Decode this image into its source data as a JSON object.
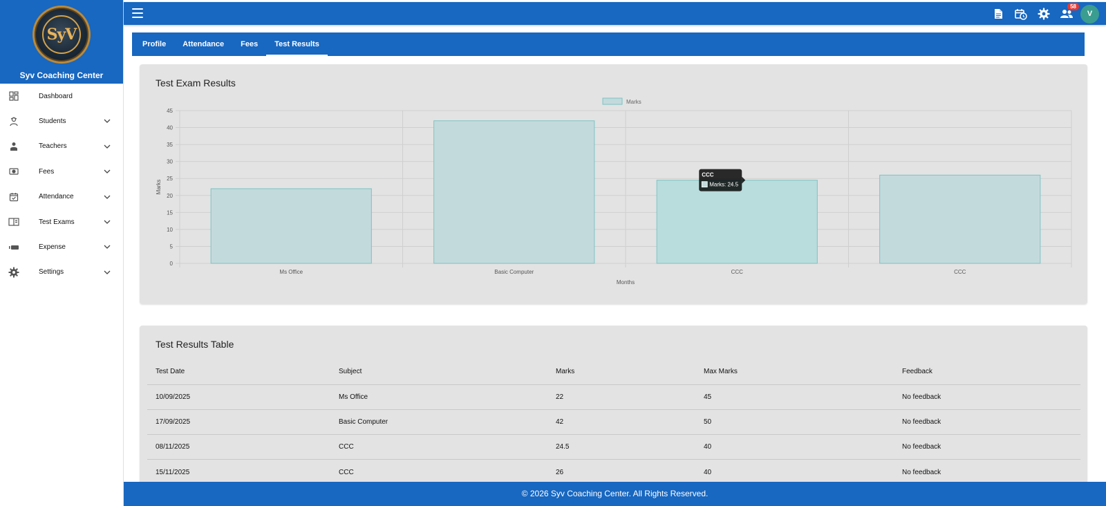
{
  "brand": {
    "logo_text": "SyV",
    "name": "Syv Coaching Center"
  },
  "sidebar": {
    "items": [
      {
        "label": "Dashboard",
        "icon": "dashboard-icon",
        "expandable": false
      },
      {
        "label": "Students",
        "icon": "student-icon",
        "expandable": true
      },
      {
        "label": "Teachers",
        "icon": "teacher-icon",
        "expandable": true
      },
      {
        "label": "Fees",
        "icon": "cash-icon",
        "expandable": true
      },
      {
        "label": "Attendance",
        "icon": "calendar-check-icon",
        "expandable": true
      },
      {
        "label": "Test Exams",
        "icon": "book-icon",
        "expandable": true
      },
      {
        "label": "Expense",
        "icon": "wallet-icon",
        "expandable": true
      },
      {
        "label": "Settings",
        "icon": "gear-icon",
        "expandable": true
      }
    ]
  },
  "topbar": {
    "notification_count": "58",
    "avatar_initial": "V"
  },
  "tabs": [
    {
      "label": "Profile",
      "active": false
    },
    {
      "label": "Attendance",
      "active": false
    },
    {
      "label": "Fees",
      "active": false
    },
    {
      "label": "Test Results",
      "active": true
    }
  ],
  "chart_section": {
    "title": "Test Exam Results"
  },
  "chart_data": {
    "type": "bar",
    "categories": [
      "Ms Office",
      "Basic Computer",
      "CCC",
      "CCC"
    ],
    "series": [
      {
        "name": "Marks",
        "values": [
          22,
          42,
          24.5,
          26
        ]
      }
    ],
    "xlabel": "Months",
    "ylabel": "Marks",
    "ylim": [
      0,
      45
    ],
    "yticks": [
      0,
      5,
      10,
      15,
      20,
      25,
      30,
      35,
      40,
      45
    ],
    "grid": true,
    "legend": "top-center",
    "bar_color": "#c3dadc",
    "bar_border": "#7ec2c2",
    "tooltip": {
      "title": "CCC",
      "label": "Marks: 24.5",
      "category_index": 2
    }
  },
  "table_section": {
    "title": "Test Results Table",
    "columns": [
      "Test Date",
      "Subject",
      "Marks",
      "Max Marks",
      "Feedback"
    ],
    "rows": [
      [
        "10/09/2025",
        "Ms Office",
        "22",
        "45",
        "No feedback"
      ],
      [
        "17/09/2025",
        "Basic Computer",
        "42",
        "50",
        "No feedback"
      ],
      [
        "08/11/2025",
        "CCC",
        "24.5",
        "40",
        "No feedback"
      ],
      [
        "15/11/2025",
        "CCC",
        "26",
        "40",
        "No feedback"
      ]
    ]
  },
  "footer": {
    "text": "© 2026 Syv Coaching Center. All Rights Reserved."
  },
  "colors": {
    "primary": "#1867c0",
    "card_bg": "#e3e3e3",
    "badge": "#e53935",
    "avatar": "#3a9d8f"
  }
}
